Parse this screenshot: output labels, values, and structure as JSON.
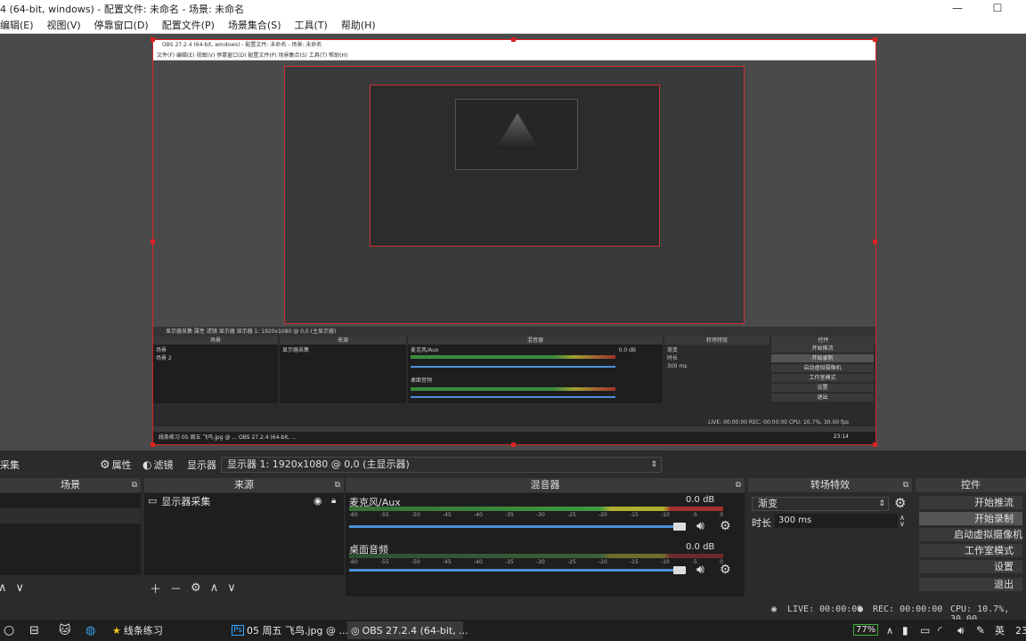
{
  "window": {
    "title": "4 (64-bit, windows) - 配置文件: 未命名 - 场景: 未命名"
  },
  "menu": [
    "编辑(E)",
    "视图(V)",
    "停靠窗口(D)",
    "配置文件(P)",
    "场景集合(S)",
    "工具(T)",
    "帮助(H)"
  ],
  "nested": {
    "title": "OBS 27.2.4 (64-bit, windows) - 配置文件: 未命名 - 场景: 未命名",
    "menu": "文件(F)    编辑(E)    视图(V)    停靠窗口(D)    配置文件(P)    场景集合(S)    工具(T)    帮助(H)",
    "toolbar": "显示器采集    属性    滤镜    显示器    显示器 1: 1920x1080 @ 0,0 (主显示器)",
    "scenes_header": "场景",
    "scene_items": [
      "场景",
      "场景 2"
    ],
    "sources_header": "来源",
    "source_item": "显示器采集",
    "mixer_header": "混音器",
    "mixer_ch1": "麦克风/Aux",
    "mixer_ch2": "桌面音频",
    "db": "0.0 dB",
    "transition_header": "转场特效",
    "transition_value": "渐变",
    "duration_label": "时长",
    "duration_value": "300 ms",
    "controls_header": "控件",
    "controls": [
      "开始推流",
      "开始录制",
      "启动虚拟摄像机",
      "工作室模式",
      "设置",
      "退出"
    ],
    "status": "LIVE: 00:00:00    REC: 00:00:00    CPU: 10.7%, 30.00 fps",
    "taskbar": "线条练习      05 周五 飞鸟.jpg @ ...      OBS 27.2.4 (64-bit, ...",
    "clock": "23:14"
  },
  "toolbar": {
    "source_label": "采集",
    "properties": "属性",
    "filters": "滤镜",
    "display_label": "显示器",
    "display_value": "显示器 1: 1920x1080 @ 0,0 (主显示器)"
  },
  "scenes": {
    "header": "场景"
  },
  "sources": {
    "header": "来源",
    "item": "显示器采集"
  },
  "mixer": {
    "header": "混音器",
    "ticks": [
      "-60",
      "-55",
      "-50",
      "-45",
      "-40",
      "-35",
      "-30",
      "-25",
      "-20",
      "-15",
      "-10",
      "-5",
      "0"
    ],
    "channels": [
      {
        "name": "麦克风/Aux",
        "db": "0.0 dB"
      },
      {
        "name": "桌面音频",
        "db": "0.0 dB"
      }
    ]
  },
  "transitions": {
    "header": "转场特效",
    "value": "渐变",
    "duration_label": "时长",
    "duration_value": "300 ms"
  },
  "controls": {
    "header": "控件",
    "buttons": [
      "开始推流",
      "开始录制",
      "启动虚拟摄像机",
      "工作室模式",
      "设置",
      "退出"
    ]
  },
  "status": {
    "live": "LIVE: 00:00:00",
    "rec": "REC: 00:00:00",
    "cpu": "CPU: 10.7%, 30.00"
  },
  "taskbar": {
    "apps": [
      "线条练习",
      "05 周五 飞鸟.jpg @ ...",
      "OBS 27.2.4 (64-bit, ..."
    ],
    "battery": "77%",
    "ime": "英",
    "clock": "23"
  },
  "colors": {
    "accent_red": "#dd2222",
    "slider_blue": "#4a90d9",
    "meter_green": "#3f9a3f"
  }
}
